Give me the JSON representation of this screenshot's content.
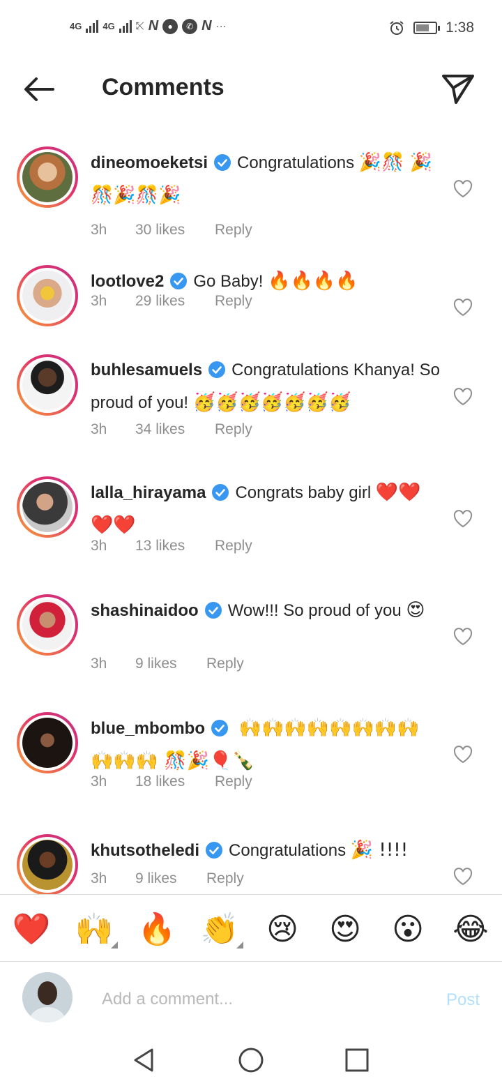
{
  "status_bar": {
    "network1": "4G",
    "network2": "4G",
    "more": "···",
    "time": "1:38"
  },
  "header": {
    "title": "Comments"
  },
  "comments": [
    {
      "username": "dineomoeketsi",
      "verified": true,
      "text": "Congratulations",
      "emojis": "🎉🎊 🎉🎊🎉🎊🎉",
      "time": "3h",
      "likes": "30 likes",
      "reply": "Reply"
    },
    {
      "username": "lootlove2",
      "verified": true,
      "text": "Go Baby!",
      "emojis": "🔥🔥🔥🔥",
      "time": "3h",
      "likes": "29 likes",
      "reply": "Reply"
    },
    {
      "username": "buhlesamuels",
      "verified": true,
      "text": "Congratulations Khanya! So proud of you!",
      "emojis": "🥳🥳🥳🥳🥳🥳🥳",
      "time": "3h",
      "likes": "34 likes",
      "reply": "Reply"
    },
    {
      "username": "lalla_hirayama",
      "verified": true,
      "text": "Congrats baby girl",
      "emojis": "❤️❤️❤️❤️",
      "time": "3h",
      "likes": "13 likes",
      "reply": "Reply"
    },
    {
      "username": "shashinaidoo",
      "verified": true,
      "text": "Wow!!! So proud of you",
      "emojis": "😍",
      "time": "3h",
      "likes": "9 likes",
      "reply": "Reply"
    },
    {
      "username": "blue_mbombo",
      "verified": true,
      "text": "",
      "emojis": "🙌🙌🙌🙌🙌🙌🙌🙌 🙌🙌🙌 🎊🎉🎈🍾",
      "time": "3h",
      "likes": "18 likes",
      "reply": "Reply"
    },
    {
      "username": "khutsotheledi",
      "verified": true,
      "text": "Congratulations",
      "emojis": "🎉 !!!!",
      "time": "3h",
      "likes": "9 likes",
      "reply": "Reply"
    }
  ],
  "reactions": [
    "❤️",
    "🙌",
    "🔥",
    "👏",
    "😢",
    "😍",
    "😮",
    "😂"
  ],
  "composer": {
    "placeholder": "Add a comment...",
    "post_label": "Post"
  },
  "colors": {
    "text": "#262626",
    "muted": "#8e8e8e",
    "verified": "#3897f0",
    "post_disabled": "#b2dffc",
    "ring_start": "#f9a334",
    "ring_end": "#c13584"
  }
}
